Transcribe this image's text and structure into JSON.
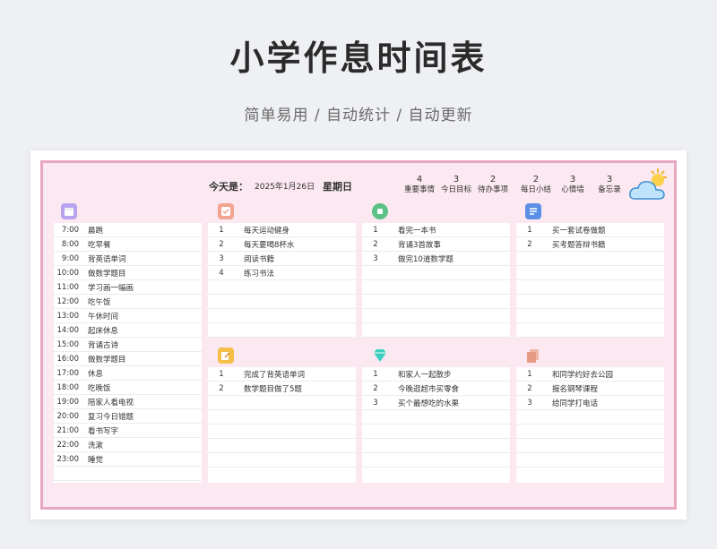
{
  "header": {
    "title": "小学作息时间表",
    "subtitle": "简单易用 / 自动统计 / 自动更新"
  },
  "topbar": {
    "today_label": "今天是：",
    "date": "2025年1月26日",
    "weekday": "星期日",
    "stats": [
      {
        "num": "4",
        "label": "重要事情"
      },
      {
        "num": "3",
        "label": "今日目标"
      },
      {
        "num": "2",
        "label": "待办事项"
      },
      {
        "num": "2",
        "label": "每日小结"
      },
      {
        "num": "3",
        "label": "心情墙"
      },
      {
        "num": "3",
        "label": "备忘录"
      }
    ]
  },
  "schedule": [
    {
      "time": "7:00",
      "task": "晨跑"
    },
    {
      "time": "8:00",
      "task": "吃早餐"
    },
    {
      "time": "9:00",
      "task": "背英语单词"
    },
    {
      "time": "10:00",
      "task": "做数学题目"
    },
    {
      "time": "11:00",
      "task": "学习画一幅画"
    },
    {
      "time": "12:00",
      "task": "吃午饭"
    },
    {
      "time": "13:00",
      "task": "午休时间"
    },
    {
      "time": "14:00",
      "task": "起床休息"
    },
    {
      "time": "15:00",
      "task": "背诵古诗"
    },
    {
      "time": "16:00",
      "task": "做数学题目"
    },
    {
      "time": "17:00",
      "task": "休息"
    },
    {
      "time": "18:00",
      "task": "吃晚饭"
    },
    {
      "time": "19:00",
      "task": "陪家人看电视"
    },
    {
      "time": "20:00",
      "task": "复习今日错题"
    },
    {
      "time": "21:00",
      "task": "看书写字"
    },
    {
      "time": "22:00",
      "task": "洗漱"
    },
    {
      "time": "23:00",
      "task": "睡觉"
    },
    {
      "time": "",
      "task": ""
    }
  ],
  "important": [
    {
      "n": "1",
      "t": "每天运动健身"
    },
    {
      "n": "2",
      "t": "每天要喝8杯水"
    },
    {
      "n": "3",
      "t": "阅读书籍"
    },
    {
      "n": "4",
      "t": "练习书法"
    },
    {
      "n": "",
      "t": ""
    },
    {
      "n": "",
      "t": ""
    },
    {
      "n": "",
      "t": ""
    },
    {
      "n": "",
      "t": ""
    }
  ],
  "goals": [
    {
      "n": "1",
      "t": "看完一本书"
    },
    {
      "n": "2",
      "t": "背诵3首故事"
    },
    {
      "n": "3",
      "t": "做完10道数学题"
    },
    {
      "n": "",
      "t": ""
    },
    {
      "n": "",
      "t": ""
    },
    {
      "n": "",
      "t": ""
    },
    {
      "n": "",
      "t": ""
    },
    {
      "n": "",
      "t": ""
    }
  ],
  "todos": [
    {
      "n": "1",
      "t": "买一套试卷做题"
    },
    {
      "n": "2",
      "t": "买考题答辩书籍"
    },
    {
      "n": "",
      "t": ""
    },
    {
      "n": "",
      "t": ""
    },
    {
      "n": "",
      "t": ""
    },
    {
      "n": "",
      "t": ""
    },
    {
      "n": "",
      "t": ""
    },
    {
      "n": "",
      "t": ""
    }
  ],
  "summary": [
    {
      "n": "1",
      "t": "完成了背英语单词"
    },
    {
      "n": "2",
      "t": "数学题目做了5题"
    },
    {
      "n": "",
      "t": ""
    },
    {
      "n": "",
      "t": ""
    },
    {
      "n": "",
      "t": ""
    },
    {
      "n": "",
      "t": ""
    },
    {
      "n": "",
      "t": ""
    }
  ],
  "mood": [
    {
      "n": "1",
      "t": "和家人一起散步"
    },
    {
      "n": "2",
      "t": "今晚逛超市买零食"
    },
    {
      "n": "3",
      "t": "买个最想吃的水果"
    },
    {
      "n": "",
      "t": ""
    },
    {
      "n": "",
      "t": ""
    },
    {
      "n": "",
      "t": ""
    },
    {
      "n": "",
      "t": ""
    }
  ],
  "memo": [
    {
      "n": "1",
      "t": "和同学约好去公园"
    },
    {
      "n": "2",
      "t": "报名钢琴课程"
    },
    {
      "n": "3",
      "t": "给同学打电话"
    },
    {
      "n": "",
      "t": ""
    },
    {
      "n": "",
      "t": ""
    },
    {
      "n": "",
      "t": ""
    },
    {
      "n": "",
      "t": ""
    }
  ],
  "icons": [
    "calendar-icon",
    "checklist-icon",
    "target-icon",
    "todo-list-icon",
    "edit-note-icon",
    "diamond-icon",
    "memo-stack-icon",
    "weather-icon"
  ],
  "colors": {
    "sheet_bg": "#fbe8f1",
    "border": "#e8a7c1"
  }
}
